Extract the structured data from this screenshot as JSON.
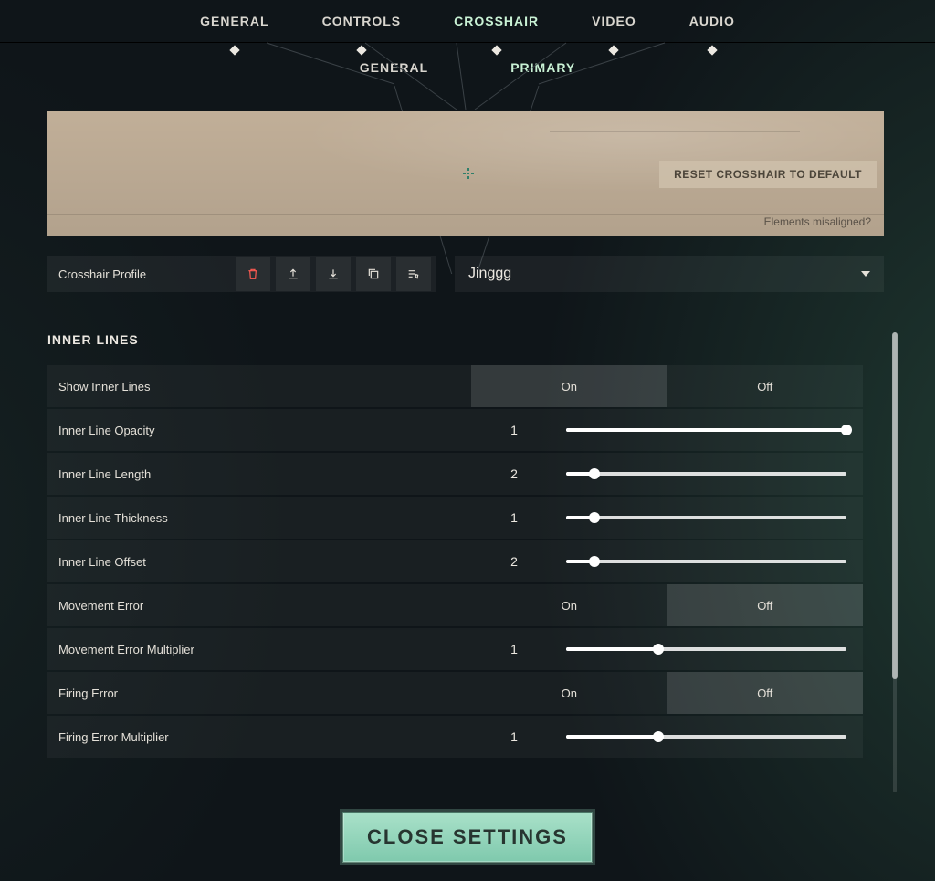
{
  "tabs": {
    "primary": [
      "GENERAL",
      "CONTROLS",
      "CROSSHAIR",
      "VIDEO",
      "AUDIO"
    ],
    "primary_active": 2,
    "sub": [
      "GENERAL",
      "PRIMARY"
    ],
    "sub_active": 1
  },
  "preview": {
    "reset_label": "RESET CROSSHAIR TO DEFAULT",
    "misaligned_label": "Elements misaligned?"
  },
  "profile": {
    "label": "Crosshair Profile",
    "selected": "Jinggg"
  },
  "section": {
    "title": "INNER LINES",
    "toggle_on": "On",
    "toggle_off": "Off",
    "rows": [
      {
        "key": "show",
        "label": "Show Inner Lines",
        "type": "toggle",
        "value": "On"
      },
      {
        "key": "opacity",
        "label": "Inner Line Opacity",
        "type": "slider",
        "display": "1",
        "percent": 100
      },
      {
        "key": "length",
        "label": "Inner Line Length",
        "type": "slider",
        "display": "2",
        "percent": 10
      },
      {
        "key": "thickness",
        "label": "Inner Line Thickness",
        "type": "slider",
        "display": "1",
        "percent": 10
      },
      {
        "key": "offset",
        "label": "Inner Line Offset",
        "type": "slider",
        "display": "2",
        "percent": 10
      },
      {
        "key": "movementError",
        "label": "Movement Error",
        "type": "toggle",
        "value": "Off"
      },
      {
        "key": "movementErrorMult",
        "label": "Movement Error Multiplier",
        "type": "slider",
        "display": "1",
        "percent": 33
      },
      {
        "key": "firingError",
        "label": "Firing Error",
        "type": "toggle",
        "value": "Off"
      },
      {
        "key": "firingErrorMult",
        "label": "Firing Error Multiplier",
        "type": "slider",
        "display": "1",
        "percent": 33
      }
    ]
  },
  "close_label": "CLOSE SETTINGS",
  "scrollbar": {
    "thumb_top": 0,
    "thumb_height": 380
  }
}
